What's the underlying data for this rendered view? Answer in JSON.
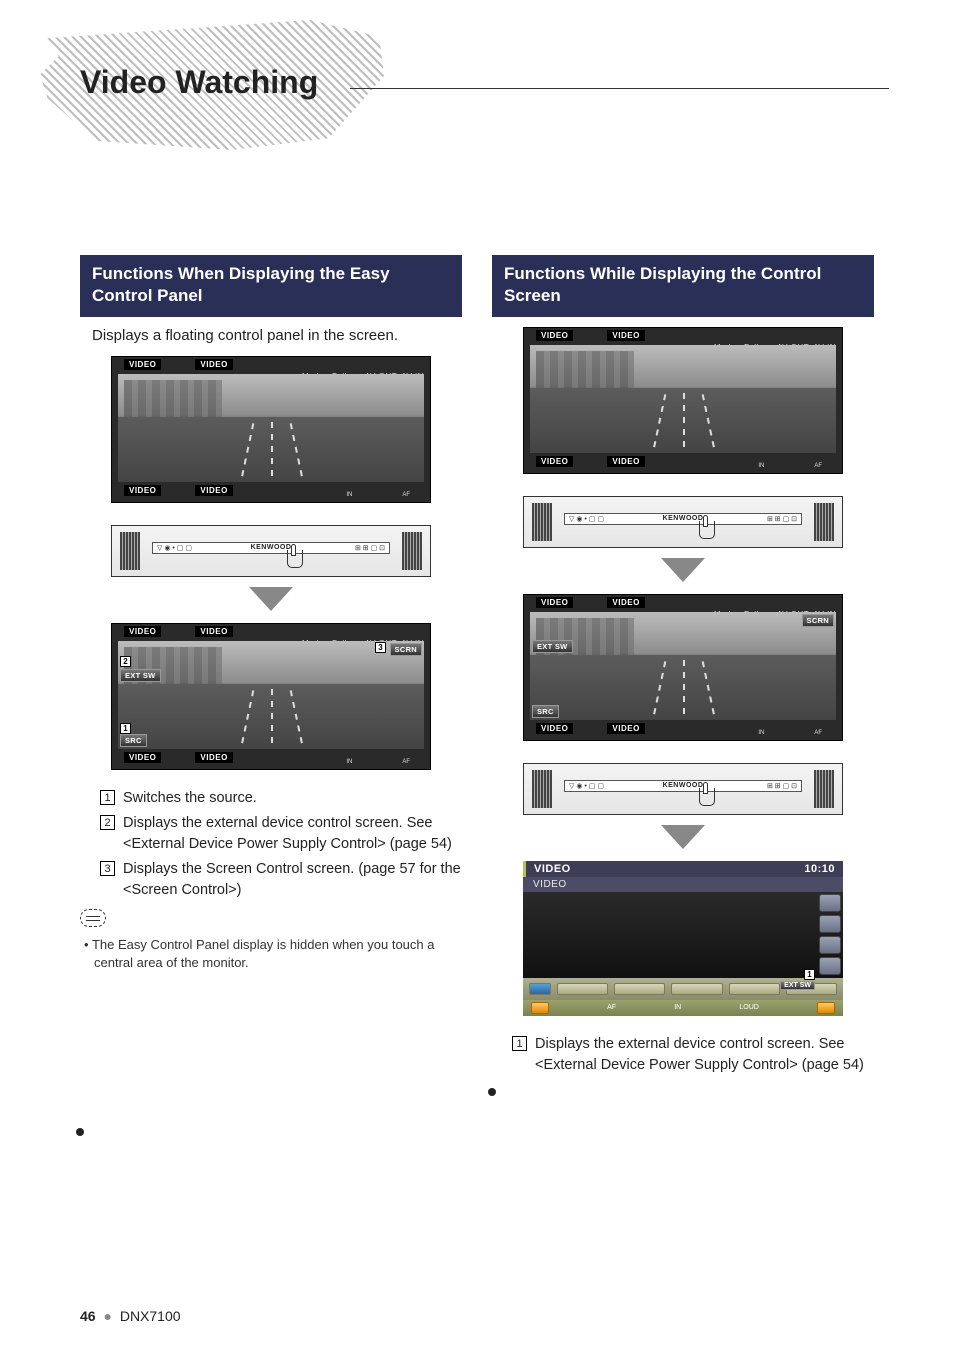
{
  "header": {
    "title": "Video Watching"
  },
  "footer": {
    "page": "46",
    "model": "DNX7100"
  },
  "left": {
    "heading": "Functions When Displaying the Easy Control Panel",
    "intro": "Displays a floating control panel in the screen.",
    "shot": {
      "video_label": "VIDEO",
      "mode": "Mode :  Full",
      "avout": "AV-OUT: AV-IN",
      "in": "IN",
      "af": "AF",
      "brand": "KENWOOD",
      "scrn": "SCRN",
      "extsw": "EXT SW",
      "src": "SRC"
    },
    "items": [
      {
        "n": "1",
        "text": "Switches the source."
      },
      {
        "n": "2",
        "text": "Displays the external device control screen. See <External Device Power Supply Control> (page 54)"
      },
      {
        "n": "3",
        "text": "Displays the Screen Control screen. (page 57 for the <Screen Control>)"
      }
    ],
    "note": "The Easy Control Panel display is hidden when you touch a central area of the monitor."
  },
  "right": {
    "heading": "Functions While Displaying the Control Screen",
    "ctrl": {
      "title": "VIDEO",
      "time": "10:10",
      "sub": "VIDEO",
      "af": "AF",
      "in": "IN",
      "loud": "LOUD",
      "extsw": "EXT SW"
    },
    "items": [
      {
        "n": "1",
        "text": "Displays the external device control screen. See <External Device Power Supply Control> (page 54)"
      }
    ]
  }
}
